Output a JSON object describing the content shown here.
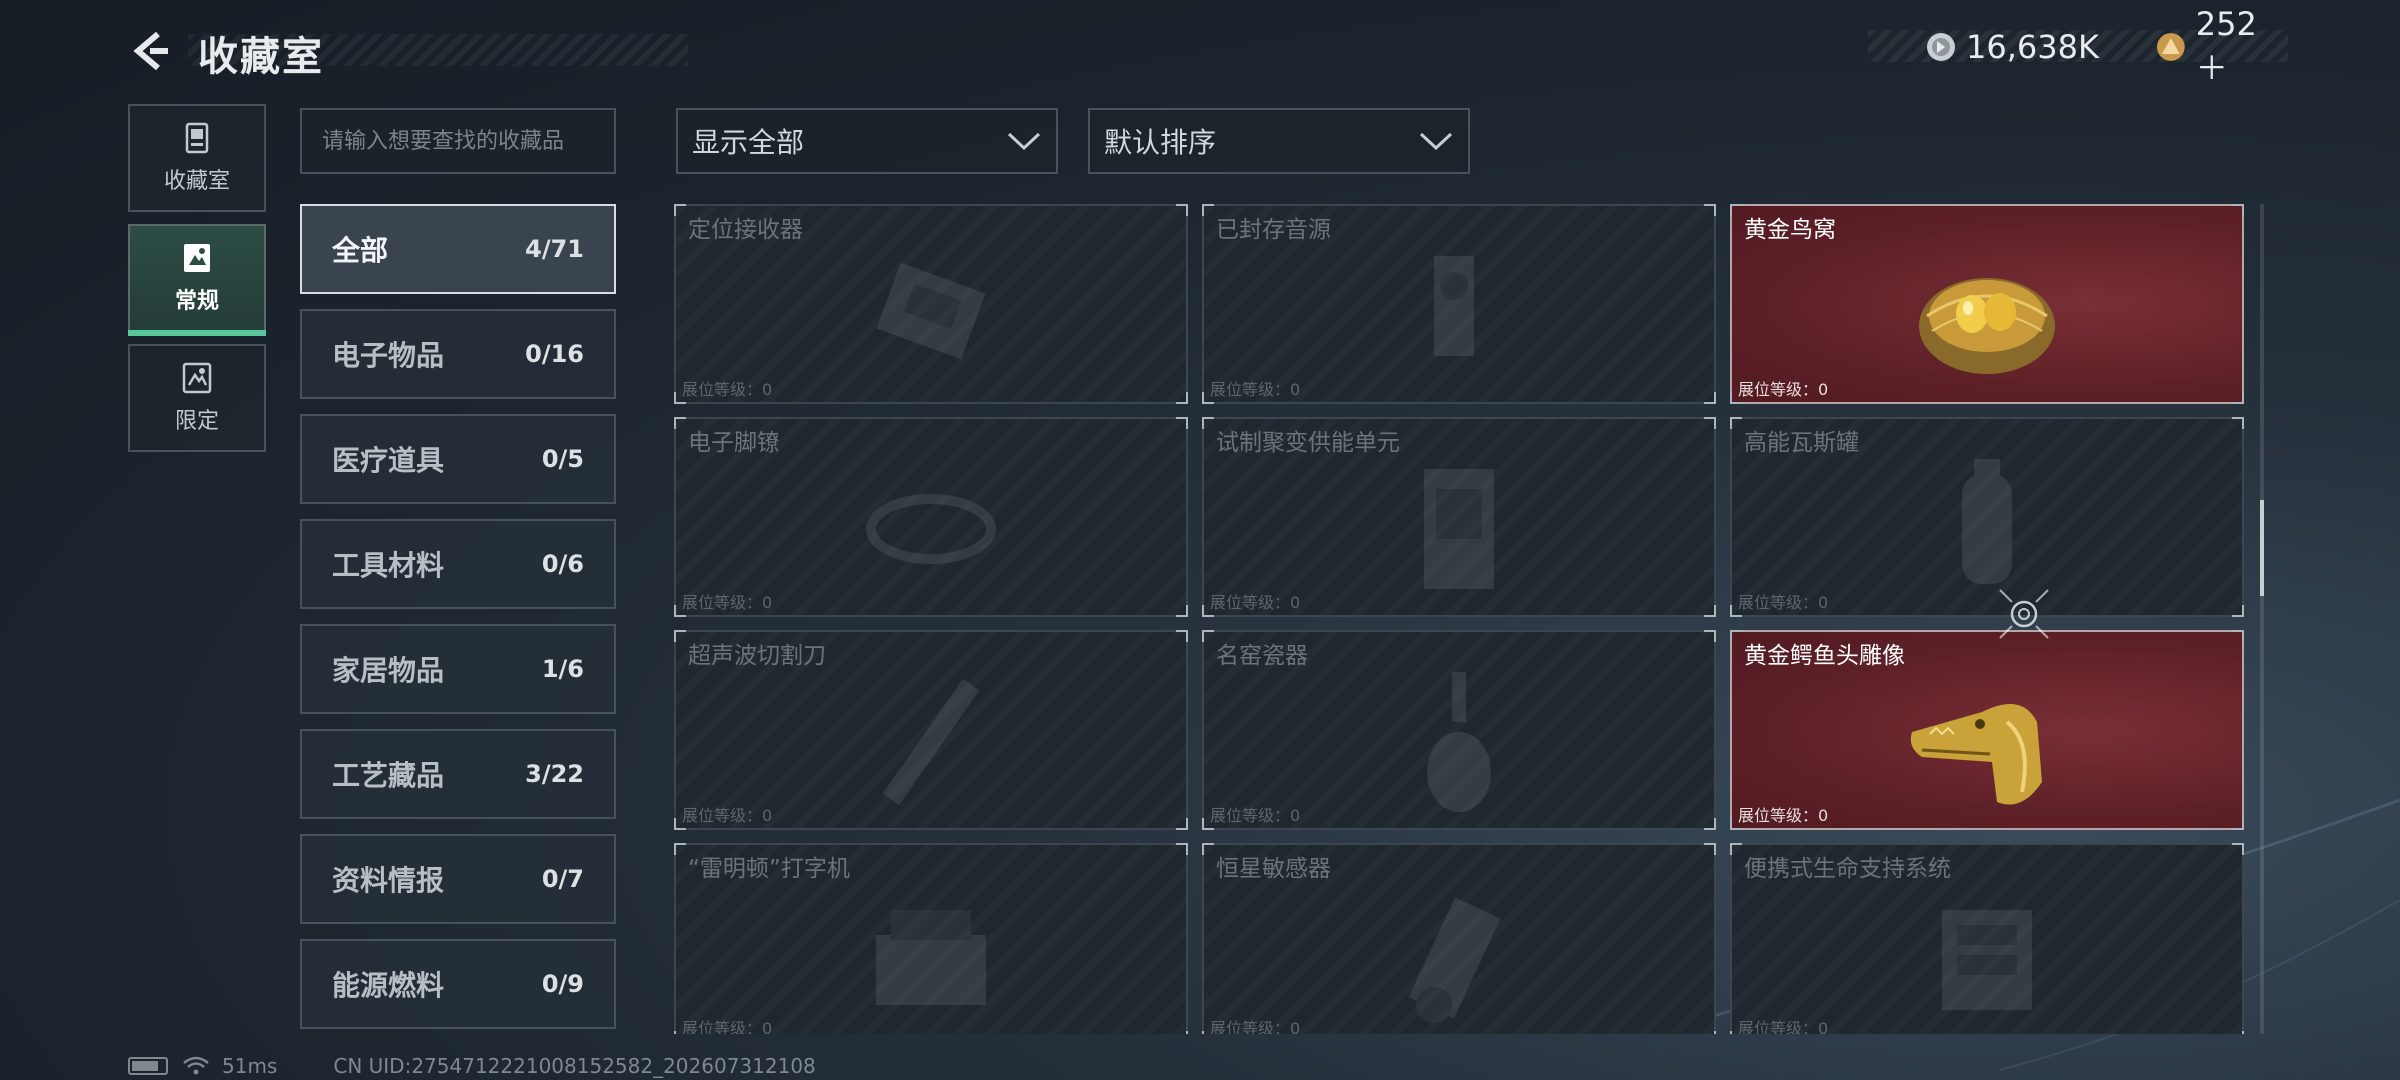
{
  "header": {
    "title": "收藏室"
  },
  "currency": [
    {
      "icon": "silver-coin-icon",
      "value": "16,638K"
    },
    {
      "icon": "gold-triangle-coin-icon",
      "value": "252＋"
    }
  ],
  "leftnav": [
    {
      "label": "收藏室",
      "icon": "collection-room-icon",
      "active": false
    },
    {
      "label": "常规",
      "icon": "regular-card-icon",
      "active": true
    },
    {
      "label": "限定",
      "icon": "limited-card-icon",
      "active": false
    }
  ],
  "search": {
    "placeholder": "请输入想要查找的收藏品",
    "value": ""
  },
  "categories": [
    {
      "label": "全部",
      "count": "4/71"
    },
    {
      "label": "电子物品",
      "count": "0/16"
    },
    {
      "label": "医疗道具",
      "count": "0/5"
    },
    {
      "label": "工具材料",
      "count": "0/6"
    },
    {
      "label": "家居物品",
      "count": "1/6"
    },
    {
      "label": "工艺藏品",
      "count": "3/22"
    },
    {
      "label": "资料情报",
      "count": "0/7"
    },
    {
      "label": "能源燃料",
      "count": "0/9"
    }
  ],
  "filters": {
    "display": "显示全部",
    "sort": "默认排序"
  },
  "items": [
    {
      "name": "定位接收器",
      "level": "展位等级：0",
      "collected": false
    },
    {
      "name": "已封存音源",
      "level": "展位等级：0",
      "collected": false
    },
    {
      "name": "黄金鸟窝",
      "level": "展位等级：0",
      "collected": true
    },
    {
      "name": "电子脚镣",
      "level": "展位等级：0",
      "collected": false
    },
    {
      "name": "试制聚变供能单元",
      "level": "展位等级：0",
      "collected": false
    },
    {
      "name": "高能瓦斯罐",
      "level": "展位等级：0",
      "collected": false
    },
    {
      "name": "超声波切割刀",
      "level": "展位等级：0",
      "collected": false
    },
    {
      "name": "名窑瓷器",
      "level": "展位等级：0",
      "collected": false
    },
    {
      "name": "黄金鳄鱼头雕像",
      "level": "展位等级：0",
      "collected": true
    },
    {
      "name": "“雷明顿”打字机",
      "level": "展位等级：0",
      "collected": false
    },
    {
      "name": "恒星敏感器",
      "level": "展位等级：0",
      "collected": false
    },
    {
      "name": "便携式生命支持系统",
      "level": "展位等级：0",
      "collected": false
    }
  ],
  "status": {
    "ping": "51ms",
    "uid": "CN UID:2754712221008152582_202607312108"
  },
  "colors": {
    "accent_green": "#56c79a",
    "collected_bg": "#5e2027",
    "gold": "#d9b13a"
  }
}
